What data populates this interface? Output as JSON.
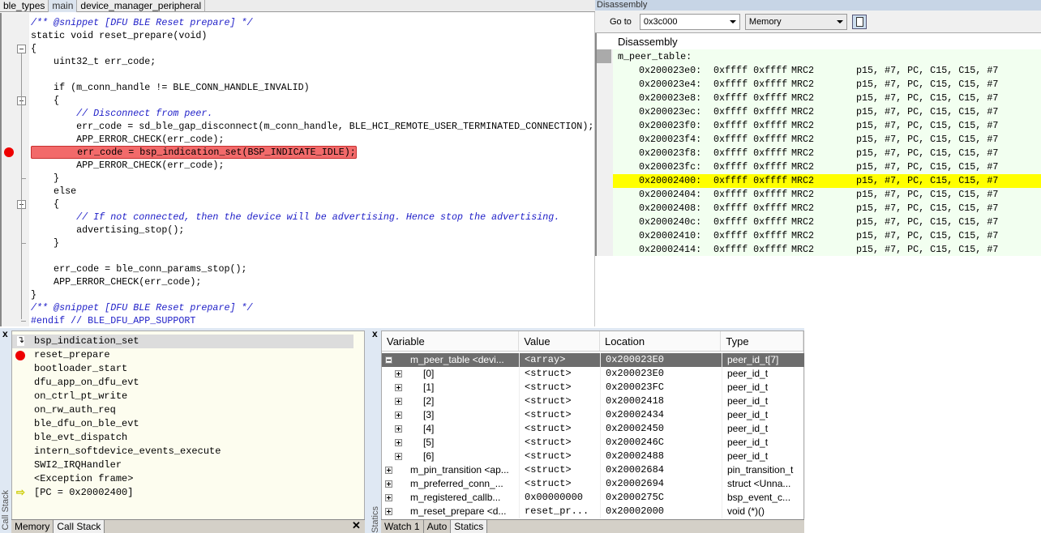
{
  "editor": {
    "tabs": [
      {
        "label": "ble_types",
        "active": false
      },
      {
        "label": "main",
        "active": true
      },
      {
        "label": "device_manager_peripheral",
        "active": false
      }
    ],
    "lines": [
      {
        "t": "/** @snippet [DFU BLE Reset prepare] */",
        "k": "comment"
      },
      {
        "t": "static void reset_prepare(void)",
        "k": "code"
      },
      {
        "t": "{",
        "k": "code"
      },
      {
        "t": "    uint32_t err_code;",
        "k": "code"
      },
      {
        "t": "",
        "k": "code"
      },
      {
        "t": "    if (m_conn_handle != BLE_CONN_HANDLE_INVALID)",
        "k": "code"
      },
      {
        "t": "    {",
        "k": "code"
      },
      {
        "t": "        // Disconnect from peer.",
        "k": "comment"
      },
      {
        "t": "        err_code = sd_ble_gap_disconnect(m_conn_handle, BLE_HCI_REMOTE_USER_TERMINATED_CONNECTION);",
        "k": "code"
      },
      {
        "t": "        APP_ERROR_CHECK(err_code);",
        "k": "code"
      },
      {
        "t": "        err_code = bsp_indication_set(BSP_INDICATE_IDLE);",
        "k": "hl"
      },
      {
        "t": "        APP_ERROR_CHECK(err_code);",
        "k": "code"
      },
      {
        "t": "    }",
        "k": "code"
      },
      {
        "t": "    else",
        "k": "code"
      },
      {
        "t": "    {",
        "k": "code"
      },
      {
        "t": "        // If not connected, then the device will be advertising. Hence stop the advertising.",
        "k": "comment"
      },
      {
        "t": "        advertising_stop();",
        "k": "code"
      },
      {
        "t": "    }",
        "k": "code"
      },
      {
        "t": "",
        "k": "code"
      },
      {
        "t": "    err_code = ble_conn_params_stop();",
        "k": "code"
      },
      {
        "t": "    APP_ERROR_CHECK(err_code);",
        "k": "code"
      },
      {
        "t": "}",
        "k": "code"
      },
      {
        "t": "/** @snippet [DFU BLE Reset prepare] */",
        "k": "comment"
      },
      {
        "t": "#endif // BLE_DFU_APP_SUPPORT",
        "k": "pre"
      }
    ]
  },
  "disassembly": {
    "title": "Disassembly",
    "goto_label": "Go to",
    "goto_value": "0x3c000",
    "mode": "Memory",
    "header": "Disassembly",
    "label": "m_peer_table:",
    "rows": [
      {
        "addr": "0x200023e0:",
        "b": "0xffff 0xffff",
        "op": "MRC2",
        "args": "p15, #7, PC, C15, C15, #7"
      },
      {
        "addr": "0x200023e4:",
        "b": "0xffff 0xffff",
        "op": "MRC2",
        "args": "p15, #7, PC, C15, C15, #7"
      },
      {
        "addr": "0x200023e8:",
        "b": "0xffff 0xffff",
        "op": "MRC2",
        "args": "p15, #7, PC, C15, C15, #7"
      },
      {
        "addr": "0x200023ec:",
        "b": "0xffff 0xffff",
        "op": "MRC2",
        "args": "p15, #7, PC, C15, C15, #7"
      },
      {
        "addr": "0x200023f0:",
        "b": "0xffff 0xffff",
        "op": "MRC2",
        "args": "p15, #7, PC, C15, C15, #7"
      },
      {
        "addr": "0x200023f4:",
        "b": "0xffff 0xffff",
        "op": "MRC2",
        "args": "p15, #7, PC, C15, C15, #7"
      },
      {
        "addr": "0x200023f8:",
        "b": "0xffff 0xffff",
        "op": "MRC2",
        "args": "p15, #7, PC, C15, C15, #7"
      },
      {
        "addr": "0x200023fc:",
        "b": "0xffff 0xffff",
        "op": "MRC2",
        "args": "p15, #7, PC, C15, C15, #7"
      },
      {
        "addr": "0x20002400:",
        "b": "0xffff 0xffff",
        "op": "MRC2",
        "args": "p15, #7, PC, C15, C15, #7",
        "current": true
      },
      {
        "addr": "0x20002404:",
        "b": "0xffff 0xffff",
        "op": "MRC2",
        "args": "p15, #7, PC, C15, C15, #7"
      },
      {
        "addr": "0x20002408:",
        "b": "0xffff 0xffff",
        "op": "MRC2",
        "args": "p15, #7, PC, C15, C15, #7"
      },
      {
        "addr": "0x2000240c:",
        "b": "0xffff 0xffff",
        "op": "MRC2",
        "args": "p15, #7, PC, C15, C15, #7"
      },
      {
        "addr": "0x20002410:",
        "b": "0xffff 0xffff",
        "op": "MRC2",
        "args": "p15, #7, PC, C15, C15, #7"
      },
      {
        "addr": "0x20002414:",
        "b": "0xffff 0xffff",
        "op": "MRC2",
        "args": "p15, #7, PC, C15, C15, #7"
      }
    ]
  },
  "callstack": {
    "side_label": "Call Stack",
    "frames": [
      {
        "name": "bsp_indication_set",
        "icon": "step-arrow",
        "selected": true
      },
      {
        "name": "reset_prepare",
        "icon": "breakpoint"
      },
      {
        "name": "bootloader_start"
      },
      {
        "name": "dfu_app_on_dfu_evt"
      },
      {
        "name": "on_ctrl_pt_write"
      },
      {
        "name": "on_rw_auth_req"
      },
      {
        "name": "ble_dfu_on_ble_evt"
      },
      {
        "name": "ble_evt_dispatch"
      },
      {
        "name": "intern_softdevice_events_execute"
      },
      {
        "name": "SWI2_IRQHandler"
      },
      {
        "name": "<Exception frame>"
      },
      {
        "name": "[PC = 0x20002400]",
        "icon": "pc-arrow"
      }
    ],
    "tabs": [
      {
        "label": "Memory"
      },
      {
        "label": "Call Stack",
        "active": true
      }
    ],
    "close": "✕"
  },
  "statics": {
    "side_label": "Statics",
    "columns": [
      "Variable",
      "Value",
      "Location",
      "Type"
    ],
    "rows": [
      {
        "var": "m_peer_table <devi...",
        "val": "<array>",
        "loc": "0x200023E0",
        "type": "peer_id_t[7]",
        "exp": "minus",
        "sel": true,
        "lvl": 0
      },
      {
        "var": "[0]",
        "val": "<struct>",
        "loc": "0x200023E0",
        "type": "peer_id_t",
        "exp": "plus",
        "lvl": 1
      },
      {
        "var": "[1]",
        "val": "<struct>",
        "loc": "0x200023FC",
        "type": "peer_id_t",
        "exp": "plus",
        "lvl": 1
      },
      {
        "var": "[2]",
        "val": "<struct>",
        "loc": "0x20002418",
        "type": "peer_id_t",
        "exp": "plus",
        "lvl": 1
      },
      {
        "var": "[3]",
        "val": "<struct>",
        "loc": "0x20002434",
        "type": "peer_id_t",
        "exp": "plus",
        "lvl": 1
      },
      {
        "var": "[4]",
        "val": "<struct>",
        "loc": "0x20002450",
        "type": "peer_id_t",
        "exp": "plus",
        "lvl": 1
      },
      {
        "var": "[5]",
        "val": "<struct>",
        "loc": "0x2000246C",
        "type": "peer_id_t",
        "exp": "plus",
        "lvl": 1
      },
      {
        "var": "[6]",
        "val": "<struct>",
        "loc": "0x20002488",
        "type": "peer_id_t",
        "exp": "plus",
        "lvl": 1
      },
      {
        "var": "m_pin_transition <ap...",
        "val": "<struct>",
        "loc": "0x20002684",
        "type": "pin_transition_t",
        "exp": "plus",
        "lvl": 0
      },
      {
        "var": "m_preferred_conn_...",
        "val": "<struct>",
        "loc": "0x20002694",
        "type": "struct <Unna...",
        "exp": "plus",
        "lvl": 0
      },
      {
        "var": "m_registered_callb...",
        "val": "0x00000000",
        "loc": "0x2000275C",
        "type": "bsp_event_c...",
        "exp": "plus",
        "lvl": 0
      },
      {
        "var": "m_reset_prepare <d...",
        "val": "reset_pr...",
        "loc": "0x20002000",
        "type": "void (*)()",
        "exp": "plus",
        "lvl": 0
      }
    ],
    "tabs": [
      {
        "label": "Watch 1"
      },
      {
        "label": "Auto"
      },
      {
        "label": "Statics",
        "active": true
      }
    ],
    "close": "x"
  },
  "colors": {
    "breakpoint": "#e00000",
    "highlight": "#f26a6a",
    "current_line": "#ffff00",
    "comment": "#2020c8"
  }
}
